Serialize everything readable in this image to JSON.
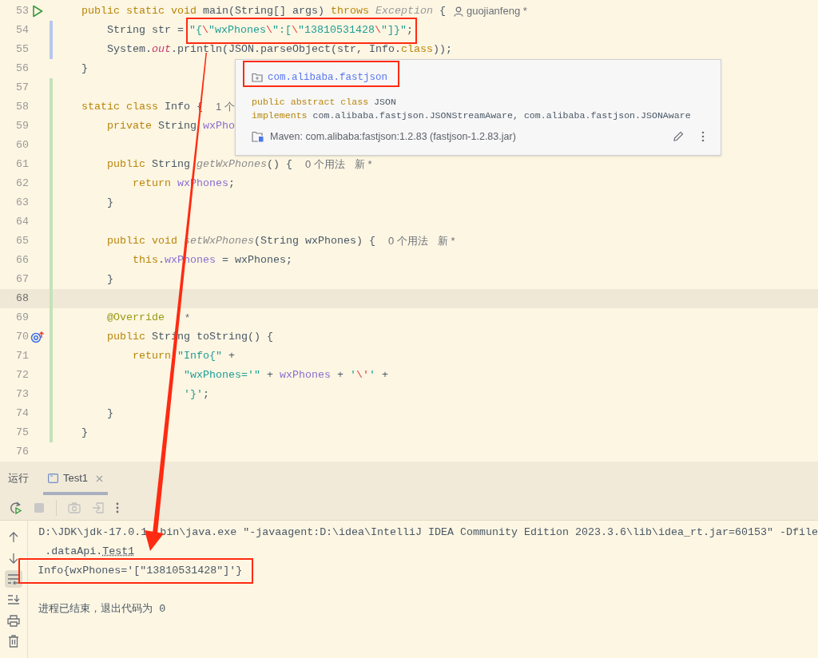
{
  "editor": {
    "lines": [
      {
        "number": "53",
        "kind": "run",
        "current": false,
        "tokens": [
          {
            "kind": "kw",
            "text": "public static void "
          },
          {
            "kind": "plain",
            "text": "main(String[] args) "
          },
          {
            "kind": "kw",
            "text": "throws "
          },
          {
            "kind": "type",
            "text": "Exception"
          },
          {
            "kind": "plain",
            "text": " {"
          }
        ],
        "owner": "guojianfeng *",
        "children": [
          {
            "number": "54",
            "kind": "code",
            "color": "#b8c6f0",
            "current": false,
            "tokens": [
              {
                "kind": "plain",
                "text": "String str = "
              }
            ],
            "boxed_tokens": [
              {
                "kind": "str",
                "text": "\"{"
              },
              {
                "kind": "esc",
                "text": "\\"
              },
              {
                "kind": "str",
                "text": "\"wxPhones"
              },
              {
                "kind": "esc",
                "text": "\\"
              },
              {
                "kind": "str",
                "text": "\":["
              },
              {
                "kind": "esc",
                "text": "\\"
              },
              {
                "kind": "str",
                "text": "\"13810531428"
              },
              {
                "kind": "esc",
                "text": "\\"
              },
              {
                "kind": "str",
                "text": "\"]}\""
              },
              {
                "kind": "plain",
                "text": ";"
              }
            ]
          },
          {
            "number": "55",
            "kind": "code",
            "color": "#b8c6f0",
            "current": false,
            "tokens": [
              {
                "kind": "plain",
                "text": "System."
              },
              {
                "kind": "static",
                "text": "out"
              },
              {
                "kind": "plain",
                "text": ".println(JSON.parseObject(str, Info."
              },
              {
                "kind": "kw",
                "text": "class"
              },
              {
                "kind": "plain",
                "text": "));"
              }
            ]
          }
        ]
      },
      {
        "number": "56",
        "kind": "code",
        "current": false,
        "tokens": [
          {
            "kind": "plain",
            "text": "}"
          }
        ]
      },
      {
        "number": "57",
        "kind": "code",
        "color": "#c3e3b8",
        "current": false
      },
      {
        "number": "58",
        "kind": "code",
        "color": "#c3e3b8",
        "current": false,
        "tokens": [
          {
            "kind": "kw",
            "text": "static class "
          },
          {
            "kind": "plain",
            "text": "Info { "
          }
        ],
        "hints": [
          "1 个"
        ],
        "children": [
          {
            "number": "59",
            "kind": "code",
            "color": "#c3e3b8",
            "current": false,
            "tokens": [
              {
                "kind": "kw",
                "text": "private "
              },
              {
                "kind": "plain",
                "text": "String "
              },
              {
                "kind": "field",
                "text": "wxPho"
              }
            ]
          },
          {
            "number": "60",
            "kind": "code",
            "color": "#c3e3b8",
            "current": false
          },
          {
            "number": "61",
            "kind": "code",
            "color": "#c3e3b8",
            "current": false,
            "tokens": [
              {
                "kind": "kw",
                "text": "public "
              },
              {
                "kind": "plain",
                "text": "String "
              },
              {
                "kind": "decl",
                "text": "getWxPhones"
              },
              {
                "kind": "plain",
                "text": "() { "
              }
            ],
            "hints": [
              "0 个用法",
              "新 *"
            ],
            "children": [
              {
                "number": "62",
                "kind": "code",
                "color": "#c3e3b8",
                "current": false,
                "tokens": [
                  {
                    "kind": "kw",
                    "text": "return "
                  },
                  {
                    "kind": "field",
                    "text": "wxPhones"
                  },
                  {
                    "kind": "plain",
                    "text": ";"
                  }
                ]
              }
            ]
          },
          {
            "number": "63",
            "kind": "code",
            "color": "#c3e3b8",
            "current": false,
            "tokens": [
              {
                "kind": "plain",
                "text": "}"
              }
            ]
          },
          {
            "number": "64",
            "kind": "code",
            "color": "#c3e3b8",
            "current": false
          },
          {
            "number": "65",
            "kind": "code",
            "color": "#c3e3b8",
            "current": false,
            "tokens": [
              {
                "kind": "kw",
                "text": "public void "
              },
              {
                "kind": "decl",
                "text": "setWxPhones"
              },
              {
                "kind": "plain",
                "text": "(String wxPhones) { "
              }
            ],
            "hints": [
              "0 个用法",
              "新 *"
            ],
            "children": [
              {
                "number": "66",
                "kind": "code",
                "color": "#c3e3b8",
                "current": false,
                "tokens": [
                  {
                    "kind": "kw",
                    "text": "this"
                  },
                  {
                    "kind": "plain",
                    "text": "."
                  },
                  {
                    "kind": "field",
                    "text": "wxPhones"
                  },
                  {
                    "kind": "plain",
                    "text": " = wxPhones;"
                  }
                ]
              }
            ]
          },
          {
            "number": "67",
            "kind": "code",
            "color": "#c3e3b8",
            "current": false,
            "tokens": [
              {
                "kind": "plain",
                "text": "}"
              }
            ]
          },
          {
            "number": "68",
            "kind": "code",
            "color": "#c3e3b8",
            "current": true
          },
          {
            "number": "69",
            "kind": "code",
            "color": "#c3e3b8",
            "current": false,
            "tokens": [
              {
                "kind": "annot",
                "text": "@Override"
              }
            ],
            "hints": [
              "*"
            ]
          },
          {
            "number": "70",
            "kind": "override",
            "color": "#c3e3b8",
            "current": false,
            "tokens": [
              {
                "kind": "kw",
                "text": "public "
              },
              {
                "kind": "plain",
                "text": "String toString() {"
              }
            ],
            "children": [
              {
                "number": "71",
                "kind": "code",
                "color": "#c3e3b8",
                "current": false,
                "tokens": [
                  {
                    "kind": "kw",
                    "text": "return "
                  },
                  {
                    "kind": "str",
                    "text": "\"Info{\""
                  },
                  {
                    "kind": "plain",
                    "text": " +"
                  }
                ],
                "children": [
                  {
                    "number": "72",
                    "kind": "continuation",
                    "color": "#c3e3b8",
                    "current": false,
                    "tokens": [
                      {
                        "kind": "str",
                        "text": "\"wxPhones='\""
                      },
                      {
                        "kind": "plain",
                        "text": " + "
                      },
                      {
                        "kind": "field",
                        "text": "wxPhones"
                      },
                      {
                        "kind": "plain",
                        "text": " + "
                      },
                      {
                        "kind": "str",
                        "text": "'"
                      },
                      {
                        "kind": "esc",
                        "text": "\\'"
                      },
                      {
                        "kind": "str",
                        "text": "'"
                      },
                      {
                        "kind": "plain",
                        "text": " +"
                      }
                    ]
                  },
                  {
                    "number": "73",
                    "kind": "continuation",
                    "color": "#c3e3b8",
                    "current": false,
                    "tokens": [
                      {
                        "kind": "str",
                        "text": "'}'"
                      },
                      {
                        "kind": "plain",
                        "text": ";"
                      }
                    ]
                  }
                ]
              }
            ]
          },
          {
            "number": "74",
            "kind": "code",
            "color": "#c3e3b8",
            "current": false,
            "tokens": [
              {
                "kind": "plain",
                "text": "}"
              }
            ]
          }
        ]
      },
      {
        "number": "75",
        "kind": "code",
        "color": "#c3e3b8",
        "current": false,
        "tokens": [
          {
            "kind": "plain",
            "text": "}"
          }
        ]
      },
      {
        "number": "76",
        "kind": "code",
        "current": false
      }
    ]
  },
  "popup": {
    "package": "com.alibaba.fastjson",
    "signature": [
      [
        {
          "kind": "kw",
          "text": "public abstract class "
        },
        {
          "kind": "plain",
          "text": "JSON"
        }
      ],
      [
        {
          "kind": "kw",
          "text": "implements "
        },
        {
          "kind": "plain",
          "text": "com.alibaba.fastjson.JSONStreamAware, com.alibaba.fastjson.JSONAware"
        }
      ]
    ],
    "library": "Maven: com.alibaba:fastjson:1.2.83 (fastjson-1.2.83.jar)"
  },
  "run_panel": {
    "title": "运行",
    "tabs": [
      {
        "label": "Test1",
        "selected": true
      }
    ],
    "toolbar": [
      {
        "kind": "rerun",
        "disabled": false
      },
      {
        "kind": "stop",
        "disabled": true
      },
      {
        "kind": "camera",
        "disabled": true
      },
      {
        "kind": "exit",
        "disabled": true
      },
      {
        "kind": "more",
        "disabled": false
      }
    ],
    "side_tools": [
      {
        "kind": "up",
        "selected": false
      },
      {
        "kind": "down",
        "selected": false
      },
      {
        "kind": "wrap",
        "selected": true
      },
      {
        "kind": "scroll-end",
        "selected": false
      },
      {
        "kind": "print",
        "selected": false
      },
      {
        "kind": "trash",
        "selected": false
      }
    ],
    "console": [
      {
        "kind": "text",
        "parts": [
          "D:\\JDK\\jdk-17.0.1",
          "bin\\java.exe \"-javaagent:D:\\idea\\IntelliJ IDEA Community Edition 2023.3.6\\lib\\idea_rt.jar=60153\" -Dfile"
        ]
      },
      {
        "kind": "link",
        "prefix": ".dataApi.",
        "link": "Test1"
      },
      {
        "kind": "boxed",
        "parts": [
          "Info{wxPhones='[\"13810531428\"]'}"
        ]
      },
      {
        "kind": "blank"
      },
      {
        "kind": "text",
        "parts": [
          "进程已结束，退出代码为 0"
        ]
      }
    ]
  }
}
